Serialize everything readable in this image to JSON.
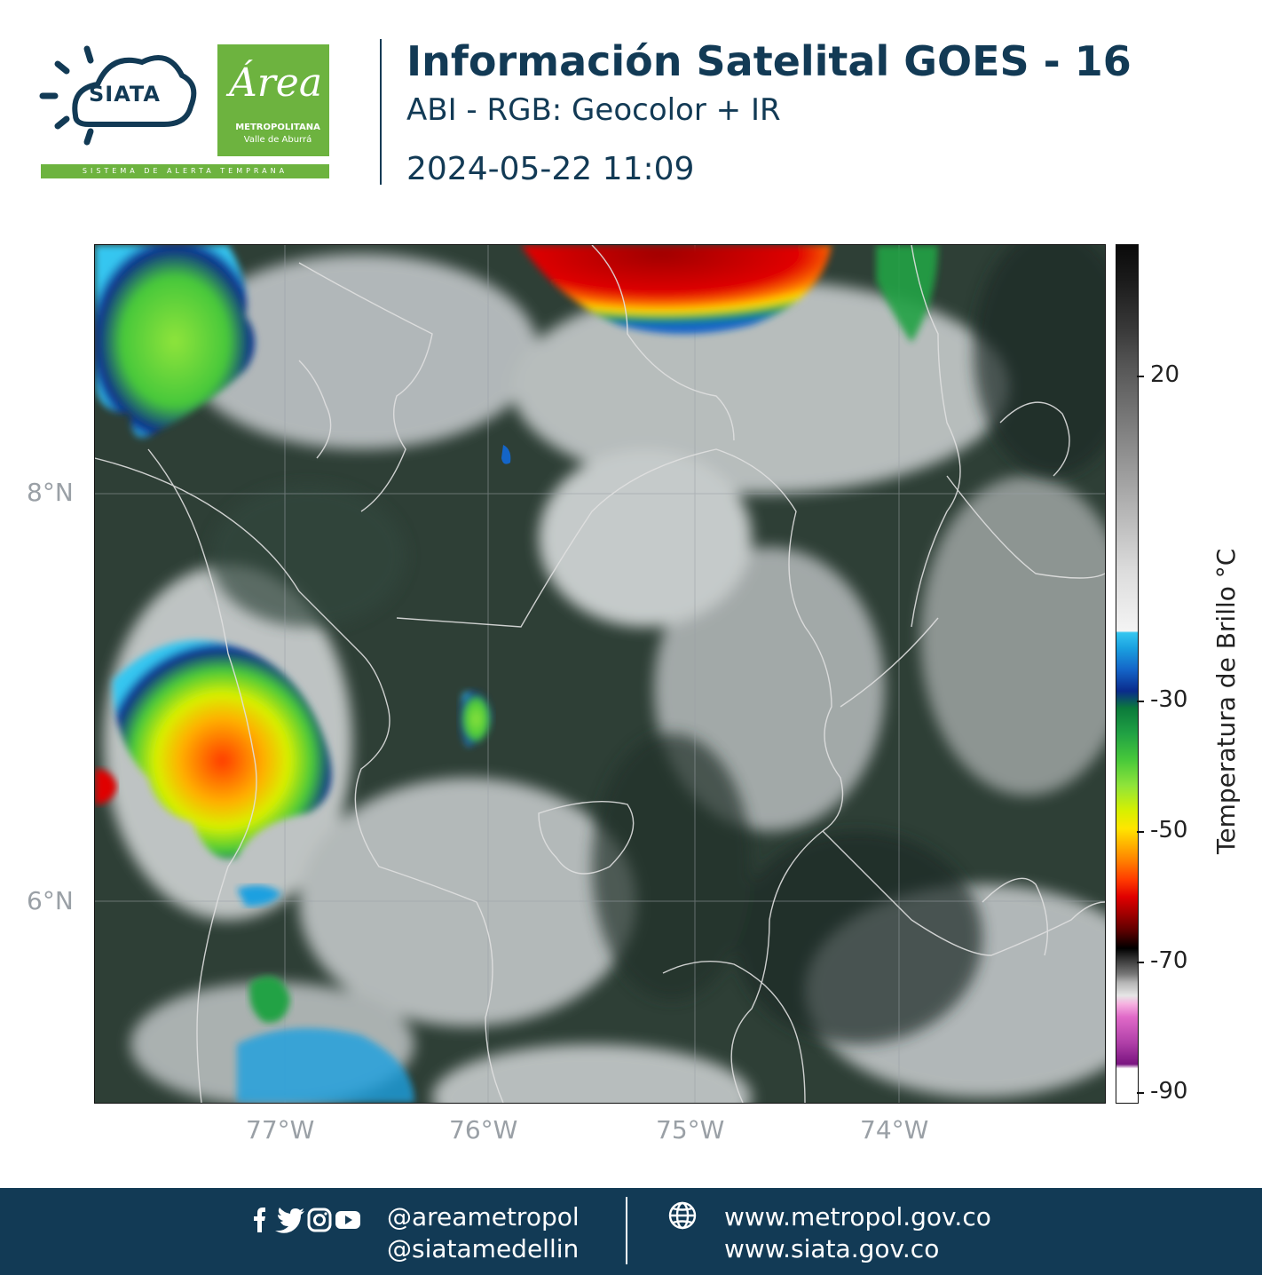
{
  "header": {
    "siata_logo_text": "SIATA",
    "siata_tagline": "SISTEMA DE ALERTA TEMPRANA",
    "area_logo_word": "Área",
    "area_logo_line1": "METROPOLITANA",
    "area_logo_line2": "Valle de Aburrá",
    "title": "Información Satelital GOES - 16",
    "subtitle": "ABI - RGB: Geocolor + IR",
    "datetime": "2024-05-22 11:09"
  },
  "map": {
    "lat_ticks": [
      "8°N",
      "6°N"
    ],
    "lon_ticks": [
      "77°W",
      "76°W",
      "75°W",
      "74°W"
    ],
    "colorbar": {
      "title": "Temperatura de Brillo °C",
      "ticks": [
        "20",
        "-30",
        "-50",
        "-70",
        "-90"
      ]
    },
    "colors": {
      "warm_cloud": "#2b3d35",
      "cold_top_green": "#47c83a",
      "cold_top_red": "#e00000",
      "border_lines": "#d9d9d9"
    }
  },
  "footer": {
    "social_icons": [
      "facebook-icon",
      "twitter-icon",
      "instagram-icon",
      "youtube-icon"
    ],
    "handle_1": "@areametropol",
    "handle_2": "@siatamedellin",
    "web_icon": "globe-icon",
    "url_1": "www.metropol.gov.co",
    "url_2": "www.siata.gov.co",
    "background": "#123a55"
  }
}
